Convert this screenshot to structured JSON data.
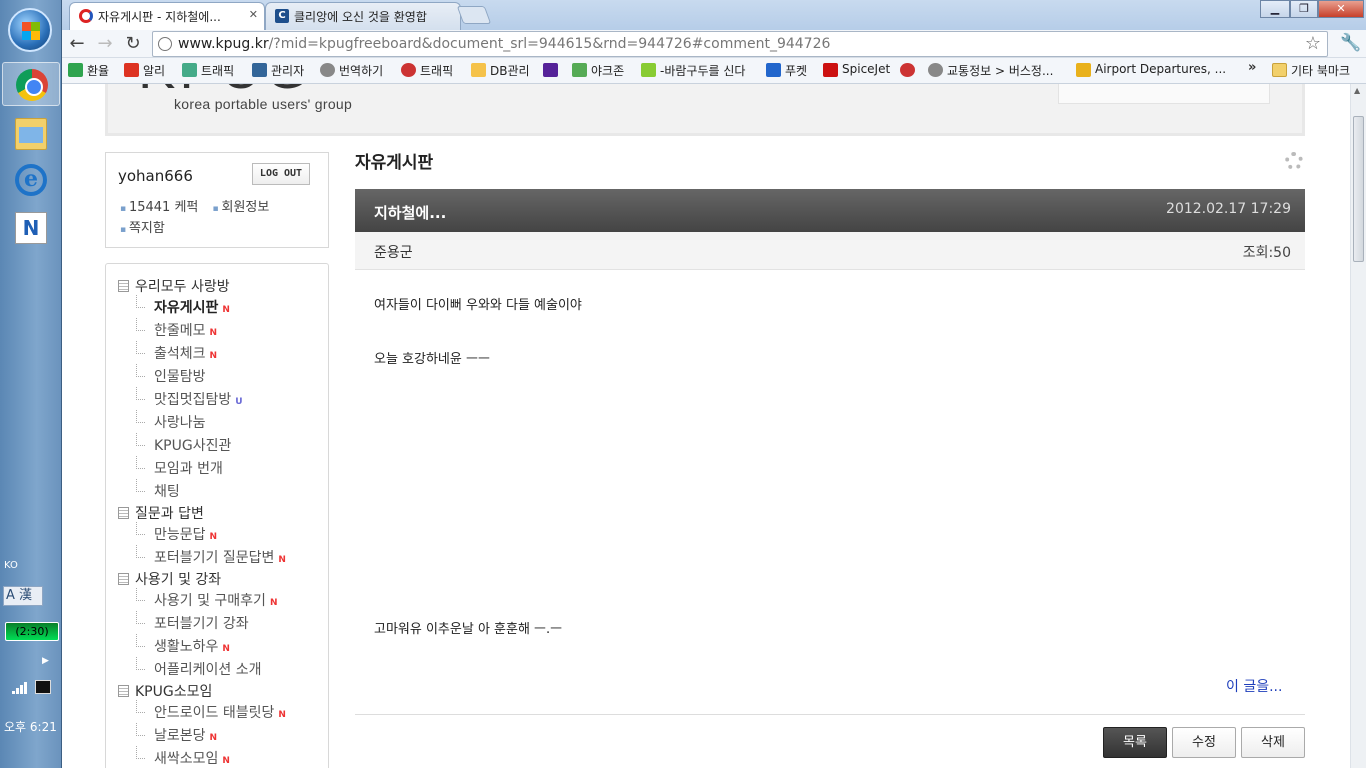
{
  "taskbar": {
    "lang": "KO",
    "ime": "A 漢",
    "battery": "(2:30)",
    "clock": "오후 6:21",
    "apps": [
      "start-orb",
      "chrome",
      "explorer",
      "internet-explorer",
      "naver-beta"
    ]
  },
  "browser": {
    "tabs": [
      {
        "title": "자유게시판 - 지하철에...",
        "active": true
      },
      {
        "title": "클리앙에 오신 것을 환영합",
        "active": false
      }
    ],
    "url_domain": "www.kpug.kr",
    "url_path": "/?mid=kpugfreeboard&document_srl=944615&rnd=944726#comment_944726",
    "bookmarks": [
      "환율",
      "알리",
      "트래픽",
      "관리자",
      "번역하기",
      "트래픽",
      "DB관리",
      "",
      "야크존",
      "-바람구두를 신다",
      "푸켓",
      "SpiceJet",
      "",
      "교통정보 > 버스정...",
      "Airport Departures, ..."
    ],
    "bookmarks_more": "»",
    "other_bookmarks": "기타 북마크"
  },
  "site": {
    "logo": "KPUG",
    "logo_sub": "korea portable users' group"
  },
  "login": {
    "user": "yohan666",
    "logout": "LOG OUT",
    "links": [
      "15441 케퍽",
      "회원정보",
      "쪽지함"
    ]
  },
  "menu": {
    "groups": [
      {
        "title": "우리모두 사랑방",
        "items": [
          {
            "label": "자유게시판",
            "badge": "N",
            "current": true
          },
          {
            "label": "한줄메모",
            "badge": "N"
          },
          {
            "label": "출석체크",
            "badge": "N"
          },
          {
            "label": "인물탐방",
            "badge": ""
          },
          {
            "label": "맛집멋집탐방",
            "badge": "U"
          },
          {
            "label": "사랑나눔",
            "badge": ""
          },
          {
            "label": "KPUG사진관",
            "badge": ""
          },
          {
            "label": "모임과 번개",
            "badge": ""
          },
          {
            "label": "채팅",
            "badge": ""
          }
        ]
      },
      {
        "title": "질문과 답변",
        "items": [
          {
            "label": "만능문답",
            "badge": "N"
          },
          {
            "label": "포터블기기 질문답변",
            "badge": "N"
          }
        ]
      },
      {
        "title": "사용기 및 강좌",
        "items": [
          {
            "label": "사용기 및 구매후기",
            "badge": "N"
          },
          {
            "label": "포터블기기 강좌",
            "badge": ""
          },
          {
            "label": "생활노하우",
            "badge": "N"
          },
          {
            "label": "어플리케이션 소개",
            "badge": ""
          }
        ]
      },
      {
        "title": "KPUG소모임",
        "items": [
          {
            "label": "안드로이드 태블릿당",
            "badge": "N"
          },
          {
            "label": "날로본당",
            "badge": "N"
          },
          {
            "label": "새싹소모임",
            "badge": "N"
          }
        ]
      }
    ]
  },
  "board": {
    "title": "자유게시판",
    "post": {
      "title": "지하철에...",
      "date": "2012.02.17 17:29",
      "author": "준용군",
      "views": "조회:50",
      "lines": [
        "여자들이 다이뻐 우와와 다들 예술이야",
        "오늘 호강하네윤 ㅡㅡ",
        "고마워유 이추운날 아 훈훈해 ㅡ.ㅡ"
      ],
      "footer_link": "이 글을..."
    },
    "buttons": {
      "list": "목록",
      "edit": "수정",
      "delete": "삭제"
    }
  }
}
